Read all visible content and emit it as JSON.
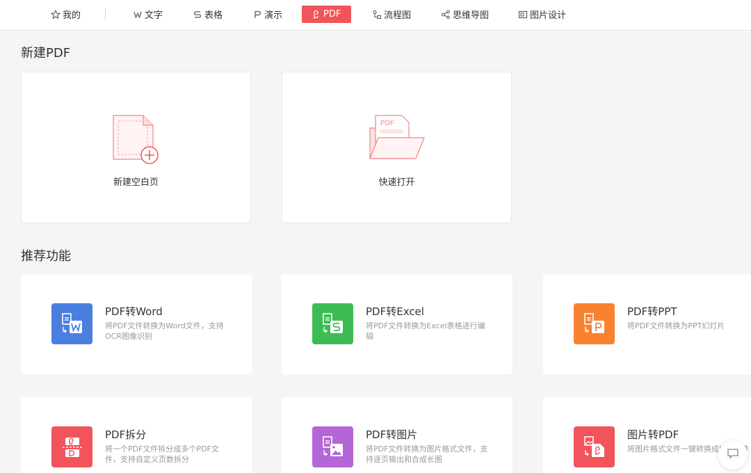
{
  "tabs": [
    {
      "label": "我的",
      "icon": "star-icon"
    },
    {
      "label": "文字",
      "icon": "w-doc-icon"
    },
    {
      "label": "表格",
      "icon": "s-sheet-icon"
    },
    {
      "label": "演示",
      "icon": "p-slides-icon"
    },
    {
      "label": "PDF",
      "icon": "pdf-icon",
      "active": true
    },
    {
      "label": "流程图",
      "icon": "flowchart-icon"
    },
    {
      "label": "思维导图",
      "icon": "mindmap-icon"
    },
    {
      "label": "图片设计",
      "icon": "image-design-icon"
    }
  ],
  "new_section": {
    "title": "新建PDF",
    "cards": [
      {
        "label": "新建空白页",
        "icon": "blank-page-plus-icon"
      },
      {
        "label": "快速打开",
        "icon": "open-folder-pdf-icon",
        "folder_text": "PDF"
      }
    ]
  },
  "recommend_section": {
    "title": "推荐功能",
    "cards": [
      {
        "title": "PDF转Word",
        "desc": "将PDF文件转换为Word文件，支持OCR图像识别",
        "color": "#4a7fe0",
        "icon": "pdf-to-word-icon"
      },
      {
        "title": "PDF转Excel",
        "desc": "将PDF文件转换为Excel表格进行编辑",
        "color": "#3dbb55",
        "icon": "pdf-to-excel-icon"
      },
      {
        "title": "PDF转PPT",
        "desc": "将PDF文件转换为PPT幻灯片",
        "color": "#f7822f",
        "icon": "pdf-to-ppt-icon"
      },
      {
        "title": "PDF拆分",
        "desc": "将一个PDF文件拆分成多个PDF文件，支持自定义页数拆分",
        "color": "#f1545a",
        "icon": "pdf-split-icon"
      },
      {
        "title": "PDF转图片",
        "desc": "将PDF文件转换为图片格式文件，支持逐页输出和合成长图",
        "color": "#b466d6",
        "icon": "pdf-to-image-icon"
      },
      {
        "title": "图片转PDF",
        "desc": "将图片格式文件一键转换成PDF文件",
        "color": "#f1545a",
        "icon": "image-to-pdf-icon"
      }
    ]
  },
  "colors": {
    "accent": "#f1545a",
    "page_bg": "#f5f5f5",
    "card_bg": "#ffffff"
  },
  "chat_button": {
    "icon": "chat-bubble-icon"
  }
}
